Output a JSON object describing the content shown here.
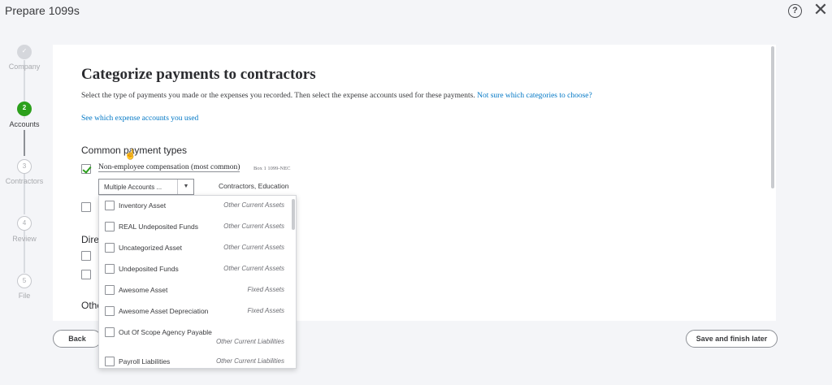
{
  "app": {
    "title": "Prepare 1099s"
  },
  "stepper": {
    "steps": [
      {
        "number": "",
        "label": "Company",
        "state": "done"
      },
      {
        "number": "2",
        "label": "Accounts",
        "state": "active"
      },
      {
        "number": "3",
        "label": "Contractors",
        "state": "todo"
      },
      {
        "number": "4",
        "label": "Review",
        "state": "todo"
      },
      {
        "number": "5",
        "label": "File",
        "state": "todo"
      }
    ]
  },
  "main": {
    "heading": "Categorize payments to contractors",
    "description": "Select the type of payments you made or the expenses you recorded. Then select the expense accounts used for these payments.",
    "help_link": "Not sure which categories to choose?",
    "accounts_link": "See which expense accounts you used",
    "common_title": "Common payment types",
    "nec": {
      "label": "Non-employee compensation (most common)",
      "box": "Box 1 1099-NEC",
      "checked": true,
      "select_value": "Multiple Accounts ...",
      "selected_summary": "Contractors, Education"
    },
    "direct_title_partial": "Dire",
    "other_title_partial": "Othe"
  },
  "dropdown": {
    "items": [
      {
        "name": "Inventory Asset",
        "type": "Other Current Assets"
      },
      {
        "name": "REAL Undeposited Funds",
        "type": "Other Current Assets"
      },
      {
        "name": "Uncategorized Asset",
        "type": "Other Current Assets"
      },
      {
        "name": "Undeposited Funds",
        "type": "Other Current Assets"
      },
      {
        "name": "Awesome Asset",
        "type": "Fixed Assets"
      },
      {
        "name": "Awesome Asset Depreciation",
        "type": "Fixed Assets"
      },
      {
        "name": "Out Of Scope Agency Payable",
        "type": "Other Current Liabilities"
      },
      {
        "name": "Payroll Liabilities",
        "type": "Other Current Liabilities"
      }
    ]
  },
  "footer": {
    "back_label": "Back",
    "save_label": "Save and finish later"
  },
  "icons": {
    "help": "help-circle-icon",
    "close": "close-icon",
    "check": "checkmark-icon",
    "caret": "caret-down-icon"
  },
  "colors": {
    "accent_green": "#2ca01c",
    "link_blue": "#0077c5"
  }
}
